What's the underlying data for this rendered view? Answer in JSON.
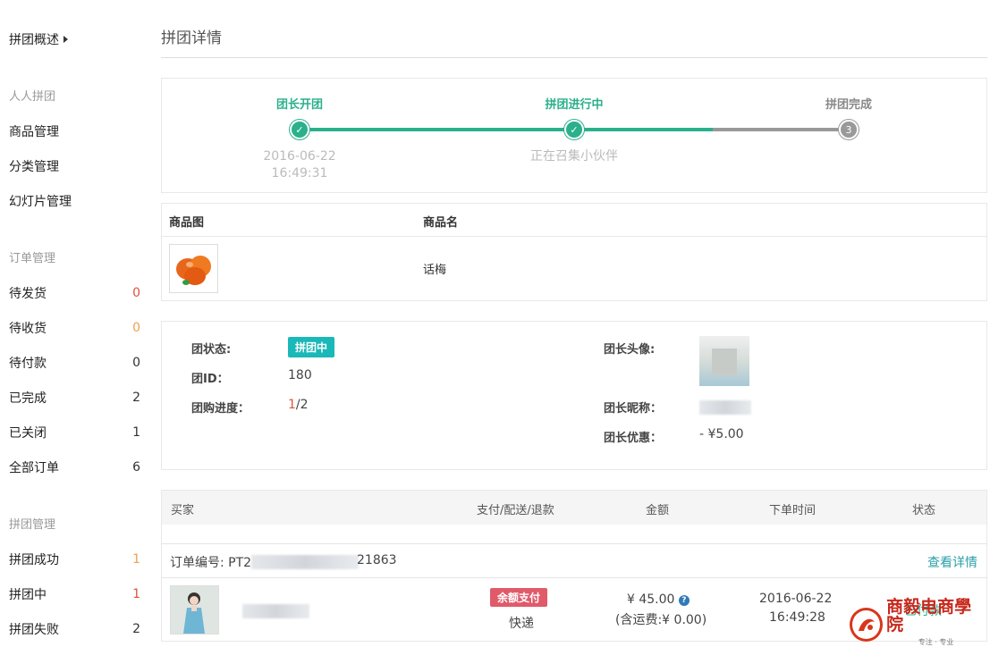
{
  "sidebar": {
    "overview": "拼团概述",
    "section_group": "人人拼团",
    "goods": "商品管理",
    "category": "分类管理",
    "slides": "幻灯片管理",
    "section_orders": "订单管理",
    "orders": [
      {
        "label": "待发货",
        "count": "0",
        "color": "#e0533a"
      },
      {
        "label": "待收货",
        "count": "0",
        "color": "#f0a050"
      },
      {
        "label": "待付款",
        "count": "0",
        "color": "#333333"
      },
      {
        "label": "已完成",
        "count": "2",
        "color": "#333333"
      },
      {
        "label": "已关闭",
        "count": "1",
        "color": "#333333"
      },
      {
        "label": "全部订单",
        "count": "6",
        "color": "#333333"
      }
    ],
    "section_groups": "拼团管理",
    "groups": [
      {
        "label": "拼团成功",
        "count": "1",
        "color": "#f0a050"
      },
      {
        "label": "拼团中",
        "count": "1",
        "color": "#e0533a"
      },
      {
        "label": "拼团失败",
        "count": "2",
        "color": "#333333"
      }
    ]
  },
  "page": {
    "title": "拼团详情"
  },
  "steps": [
    {
      "title": "团长开团",
      "sub_line1": "2016-06-22",
      "sub_line2": "16:49:31",
      "state": "done"
    },
    {
      "title": "拼团进行中",
      "sub_line1": "正在召集小伙伴",
      "sub_line2": "",
      "state": "done"
    },
    {
      "title": "拼团完成",
      "number": "3",
      "state": "pending"
    }
  ],
  "step_icons": {
    "done": "check-icon"
  },
  "colors": {
    "accent": "#2bb08c",
    "pending": "#999999",
    "teal": "#1ab8b8",
    "pay": "#e05a6a",
    "link": "#2a9fa8"
  },
  "product": {
    "col_image": "商品图",
    "col_name": "商品名",
    "name": "话梅"
  },
  "group_info": {
    "status_label": "团状态:",
    "status_value": "拼团中",
    "id_label": "团ID：",
    "id_value": "180",
    "progress_label": "团购进度：",
    "progress_current": "1",
    "progress_total": "/2",
    "avatar_label": "团长头像:",
    "nickname_label": "团长昵称：",
    "discount_label": "团长优惠：",
    "discount_value": "- ¥5.00"
  },
  "orders_table": {
    "col_buyer": "买家",
    "col_pay": "支付/配送/退款",
    "col_amount": "金额",
    "col_time": "下单时间",
    "col_status": "状态",
    "order_no_label": "订单编号: PT2",
    "order_no_tail": "21863",
    "view_detail": "查看详情",
    "pay_method": "余额支付",
    "delivery": "快递",
    "amount": "¥ 45.00",
    "help_glyph": "?",
    "shipping": "(含运费:¥ 0.00)",
    "date": "2016-06-22",
    "time": "16:49:28",
    "status": "已付款"
  },
  "watermark": {
    "name": "商毅电商學院",
    "slogan": "专注 · 专业"
  }
}
